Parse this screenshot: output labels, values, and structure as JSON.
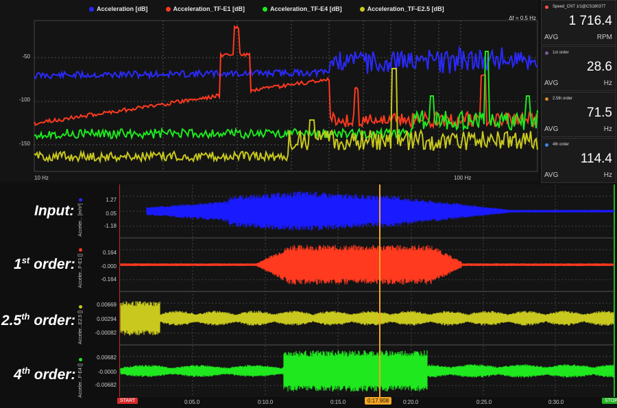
{
  "spectrum": {
    "legend": [
      {
        "label": "Acceleration [dB]",
        "color": "#2626ff"
      },
      {
        "label": "Acceleration_TF-E1 [dB]",
        "color": "#ff3a1f"
      },
      {
        "label": "Acceleration_TF-E4 [dB]",
        "color": "#1fe81f"
      },
      {
        "label": "Acceleration_TF-E2.5 [dB]",
        "color": "#c8c81e"
      }
    ],
    "df_label": "Δf = 0.5 Hz",
    "y_ticks": [
      "-50",
      "-100",
      "-150"
    ],
    "x_ticks": [
      "10 Hz",
      "100 Hz"
    ]
  },
  "readouts": [
    {
      "title": "Speed_CNT 1/1@CS180377",
      "dot": "#ff4d4d",
      "value": "1 716.4",
      "avg": "AVG",
      "unit": "RPM"
    },
    {
      "title": "1st order",
      "dot": "#7a5a9a",
      "value": "28.6",
      "avg": "AVG",
      "unit": "Hz"
    },
    {
      "title": "2.5th order",
      "dot": "#d98a2a",
      "value": "71.5",
      "avg": "AVG",
      "unit": "Hz"
    },
    {
      "title": "4th order",
      "dot": "#3a8ae6",
      "value": "114.4",
      "avg": "AVG",
      "unit": "Hz"
    }
  ],
  "rows": [
    {
      "label_main": "Input:",
      "label_sup": "",
      "label_rest": "",
      "channel": "Acceler... [m/s²]",
      "dot": "#2626ff",
      "ticks": [
        "1.27",
        "0.05",
        "-1.18"
      ],
      "color": "#1a1aff"
    },
    {
      "label_main": "1",
      "label_sup": "st",
      "label_rest": " order:",
      "channel": "Acceler...F-E1 []",
      "dot": "#ff3a1f",
      "ticks": [
        "0.164",
        "-0.000",
        "-0.164"
      ],
      "color": "#ff3a1f"
    },
    {
      "label_main": "2.5",
      "label_sup": "th",
      "label_rest": " order:",
      "channel": "Acceler...E2.5 []",
      "dot": "#c8c81e",
      "ticks": [
        "0.00669",
        "0.00294",
        "-0.00082"
      ],
      "color": "#c8c81e"
    },
    {
      "label_main": "4",
      "label_sup": "th",
      "label_rest": " order:",
      "channel": "Acceler...F-E4 []",
      "dot": "#1fe81f",
      "ticks": [
        "0.00682",
        "-0.0000",
        "-0.00682"
      ],
      "color": "#1fe81f"
    }
  ],
  "timeline": {
    "start": "START",
    "stop": "STOP",
    "cursor": "0:17.908",
    "ticks": [
      "0:05.0",
      "0:10.0",
      "0:15.0",
      "0:20.0",
      "0:25.0",
      "0:30.0"
    ]
  }
}
